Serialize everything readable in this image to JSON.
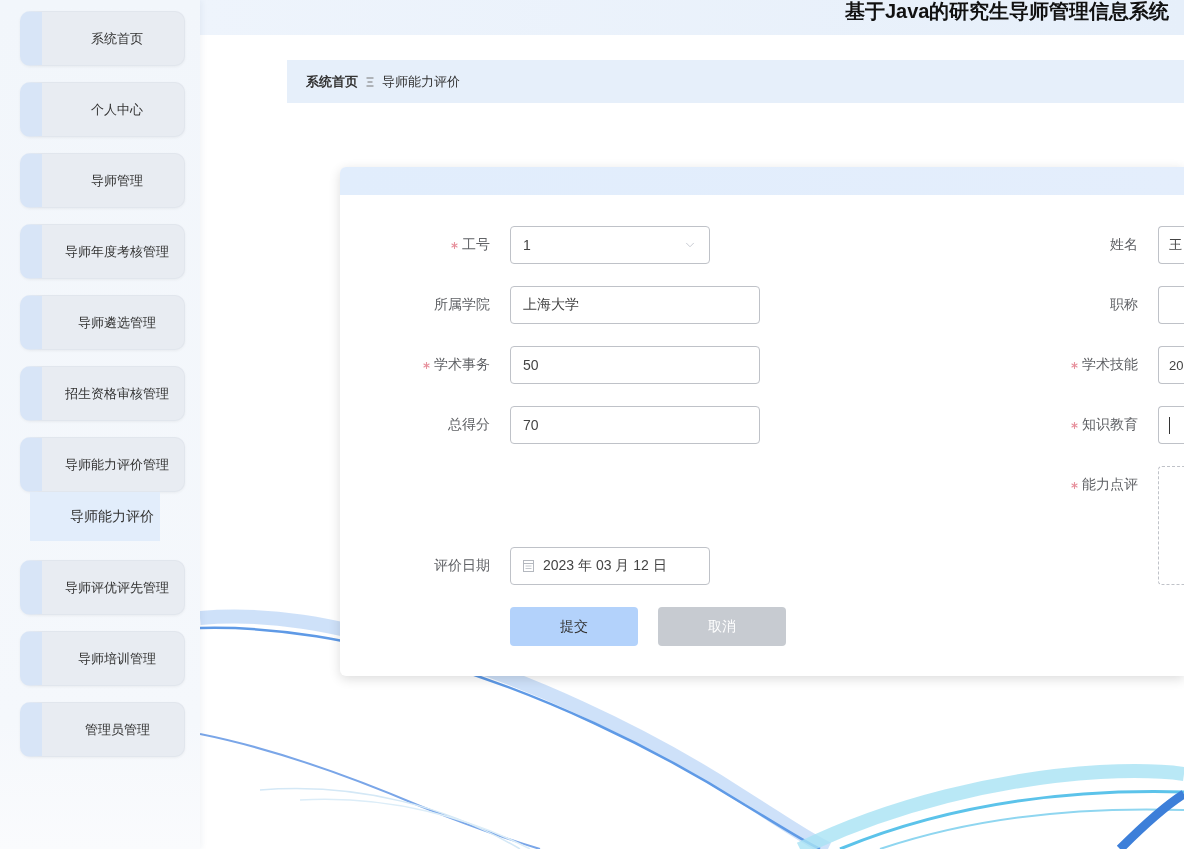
{
  "header": {
    "title": "基于Java的研究生导师管理信息系统"
  },
  "sidebar": {
    "items": [
      {
        "label": "系统首页"
      },
      {
        "label": "个人中心"
      },
      {
        "label": "导师管理"
      },
      {
        "label": "导师年度考核管理"
      },
      {
        "label": "导师遴选管理"
      },
      {
        "label": "招生资格审核管理"
      },
      {
        "label": "导师能力评价管理",
        "children": [
          {
            "label": "导师能力评价",
            "selected": true
          }
        ]
      },
      {
        "label": "导师评优评先管理"
      },
      {
        "label": "导师培训管理"
      },
      {
        "label": "管理员管理"
      }
    ]
  },
  "breadcrumb": [
    {
      "label": "系统首页"
    },
    {
      "label": "导师能力评价"
    }
  ],
  "form": {
    "rows": [
      {
        "left": {
          "kind": "select",
          "label": "工号",
          "required": true,
          "value": "1",
          "focused": false
        },
        "right": {
          "kind": "input",
          "label": "姓名",
          "required": false,
          "value": "王",
          "focused": false
        }
      },
      {
        "left": {
          "kind": "input",
          "label": "所属学院",
          "required": false,
          "value": "上海大学",
          "focused": false
        },
        "right": {
          "kind": "input",
          "label": "职称",
          "required": false,
          "focused": false
        }
      },
      {
        "left": {
          "kind": "input",
          "label": "学术事务",
          "required": true,
          "value": "50",
          "focused": false
        },
        "right": {
          "kind": "input",
          "label": "学术技能",
          "required": true,
          "value": "20",
          "focused": false
        }
      },
      {
        "left": {
          "kind": "input",
          "label": "总得分",
          "required": false,
          "value": "70",
          "focused": false
        },
        "right": {
          "kind": "input",
          "label": "知识教育",
          "required": true,
          "focused": true
        }
      },
      {
        "right": {
          "kind": "textarea",
          "label": "能力点评",
          "required": true,
          "focused": false
        }
      },
      {
        "left": {
          "kind": "date",
          "label": "评价日期",
          "required": false,
          "value": "2023 年 03 月 12 日",
          "focused": false
        }
      }
    ],
    "buttons": [
      {
        "label": "提交",
        "kind": "primary"
      },
      {
        "label": "取消",
        "kind": "cancel"
      }
    ]
  }
}
